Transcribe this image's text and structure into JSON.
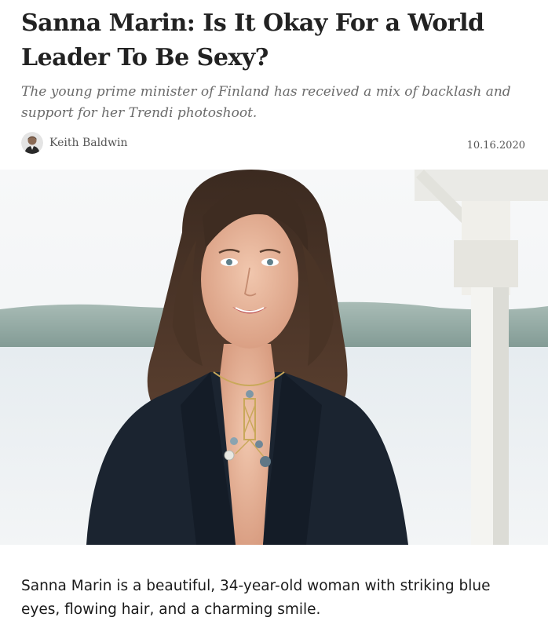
{
  "article": {
    "headline": "Sanna Marin: Is It Okay For a World Leader To Be Sexy?",
    "subtitle": "The young prime minister of Finland has received a mix of backlash and support for her Trendi photoshoot.",
    "author": "Keith Baldwin",
    "date": "10.16.2020",
    "lead_paragraph": "Sanna Marin is a beautiful, 34-year-old woman with striking blue eyes, flowing hair, and a charming smile."
  },
  "icons": {
    "avatar": "author-avatar",
    "hero": "hero-photo"
  },
  "colors": {
    "headline": "#222222",
    "subtitle": "#6b6b6b",
    "meta": "#555555",
    "body_text": "#1a1a1a"
  }
}
